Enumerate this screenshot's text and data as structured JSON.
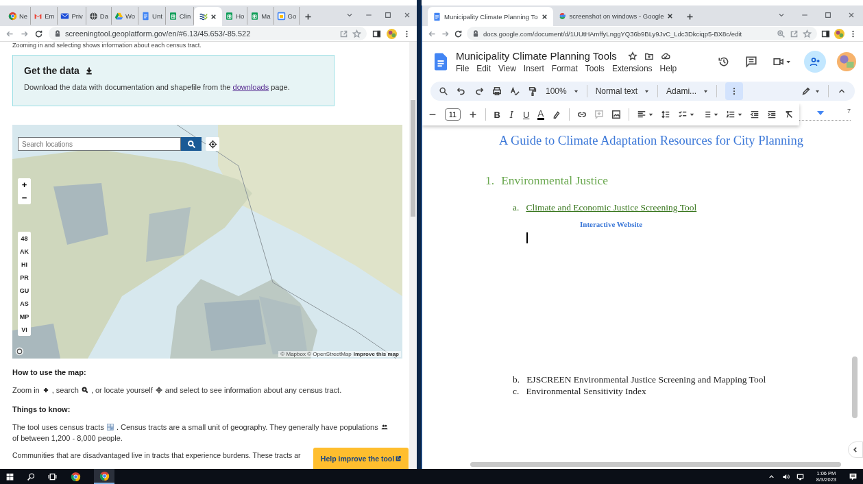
{
  "left_window": {
    "tabs": [
      {
        "kind": "chrome",
        "title": "Ne",
        "selected": false
      },
      {
        "kind": "gmail",
        "title": "Em",
        "selected": false
      },
      {
        "kind": "mail",
        "title": "Priv",
        "selected": false
      },
      {
        "kind": "globe",
        "title": "Da",
        "selected": false
      },
      {
        "kind": "drive",
        "title": "Wo",
        "selected": false
      },
      {
        "kind": "docs",
        "title": "Unt",
        "selected": false
      },
      {
        "kind": "sheets",
        "title": "Clin",
        "selected": false
      },
      {
        "kind": "screening",
        "selected": true
      },
      {
        "kind": "sheets",
        "title": "Ho",
        "selected": false
      },
      {
        "kind": "sheets",
        "title": "Ma",
        "selected": false
      },
      {
        "kind": "calendar",
        "title": "Go",
        "selected": false
      }
    ],
    "url": "screeningtool.geoplatform.gov/en/#6.13/45.653/-85.522",
    "intro_cut": "Zooming in and selecting shows information about each census tract.",
    "get_data": {
      "title": "Get the data",
      "before": "Download the data with documentation and shapefile from the",
      "link": "downloads",
      "after": "page."
    },
    "map": {
      "search_placeholder": "Search locations",
      "zoom_in": "+",
      "zoom_out": "−",
      "regions": [
        "48",
        "AK",
        "HI",
        "PR",
        "GU",
        "AS",
        "MP",
        "VI"
      ],
      "attribution": "© Mapbox © OpenStreetMap",
      "improve_link": "Improve this map"
    },
    "how_to": {
      "heading": "How to use the map:",
      "parts": [
        {
          "kind": "text",
          "text": "Zoom in"
        },
        {
          "kind": "plus"
        },
        {
          "kind": "text",
          "text": ", search"
        },
        {
          "kind": "magnifier"
        },
        {
          "kind": "text",
          "text": ", or locate yourself"
        },
        {
          "kind": "locate"
        },
        {
          "kind": "text",
          "text": "and select to see information about any census tract."
        }
      ]
    },
    "things": {
      "heading": "Things to know:",
      "parts": [
        {
          "kind": "text",
          "text": "The tool uses census tracts"
        },
        {
          "kind": "tract"
        },
        {
          "kind": "text",
          "text": ". Census tracts are a small unit of geography. They generally have populations"
        },
        {
          "kind": "people"
        },
        {
          "kind": "text",
          "text": "of between 1,200 - 8,000 people."
        }
      ],
      "cut_line": "Communities that are disadvantaged live in tracts that experience burdens. These tracts ar"
    },
    "help_button": "Help improve the tool"
  },
  "right_window": {
    "tabs": [
      {
        "kind": "docs",
        "title": "Municipality Climate Planning To",
        "selected": true
      },
      {
        "kind": "google",
        "title": "screenshot on windows - Google",
        "selected": false
      }
    ],
    "url": "docs.google.com/document/d/1UUtHAmffyLnggYQ36b9BLy9JvC_Ldc3Dkciqp5-BX8c/edit",
    "doc_title": "Municipality Climate Planning Tools",
    "menu": [
      "File",
      "Edit",
      "View",
      "Insert",
      "Format",
      "Tools",
      "Extensions",
      "Help"
    ],
    "toolbar": {
      "zoom": "100%",
      "style": "Normal text",
      "font": "Adami...",
      "more_open": true
    },
    "font_size": "11",
    "text_format": [
      "B",
      "I",
      "U",
      "A"
    ],
    "ruler_mark": "7",
    "document": {
      "title": "A Guide to Climate Adaptation Resources for City Planning",
      "sections": [
        {
          "number": "1.",
          "heading": "Environmental Justice",
          "items": [
            {
              "marker": "a.",
              "text": "Climate and Economic Justice Screening Tool",
              "link": true,
              "note": "Interactive Website"
            },
            {
              "marker": "b.",
              "text": "EJSCREEN Environmental Justice Screening and Mapping Tool",
              "link": false
            },
            {
              "marker": "c.",
              "text": "Environmental Sensitivity Index",
              "link": false
            }
          ]
        }
      ]
    }
  },
  "taskbar": {
    "apps": [
      {
        "kind": "chrome",
        "selected": false
      },
      {
        "kind": "chrome",
        "selected": true
      }
    ],
    "time": "1:06 PM",
    "date": "8/3/2023"
  }
}
